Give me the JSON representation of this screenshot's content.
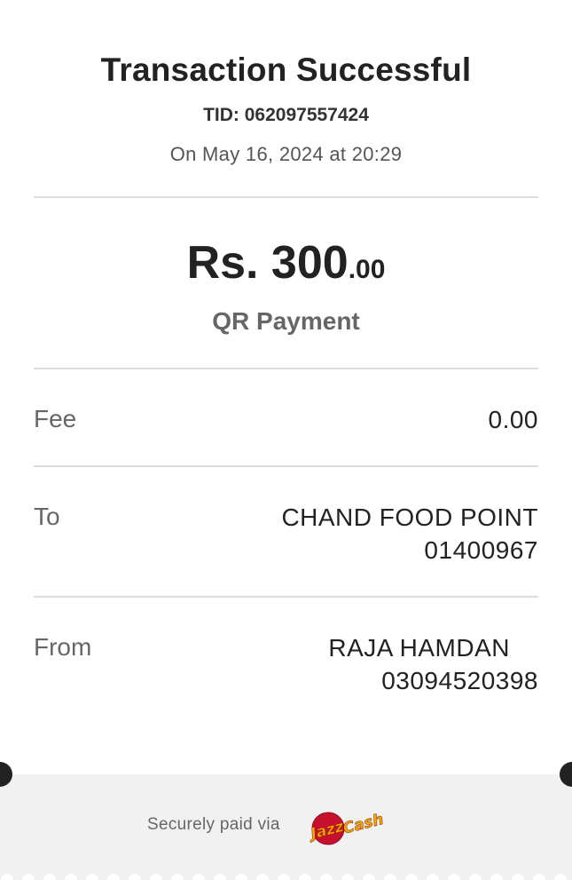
{
  "header": {
    "title": "Transaction Successful",
    "tid": "TID: 062097557424",
    "date": "On May 16, 2024 at 20:29"
  },
  "amount": {
    "main": "Rs. 300",
    "decimal": ".00",
    "payment_type": "QR Payment"
  },
  "rows": {
    "fee": {
      "label": "Fee",
      "value": "0.00"
    },
    "to": {
      "label": "To",
      "name": "CHAND FOOD POINT",
      "number": "01400967"
    },
    "from": {
      "label": "From",
      "name": "RAJA HAMDAN",
      "number": "03094520398"
    }
  },
  "footer": {
    "secure_text": "Securely paid via",
    "logo_text": "JazzCash"
  },
  "colors": {
    "text_primary": "#222222",
    "text_secondary": "#666666",
    "divider": "#dcdcdc",
    "footer_bg": "#f2f1f1",
    "logo_red": "#c8102e",
    "logo_orange": "#f7a600"
  }
}
